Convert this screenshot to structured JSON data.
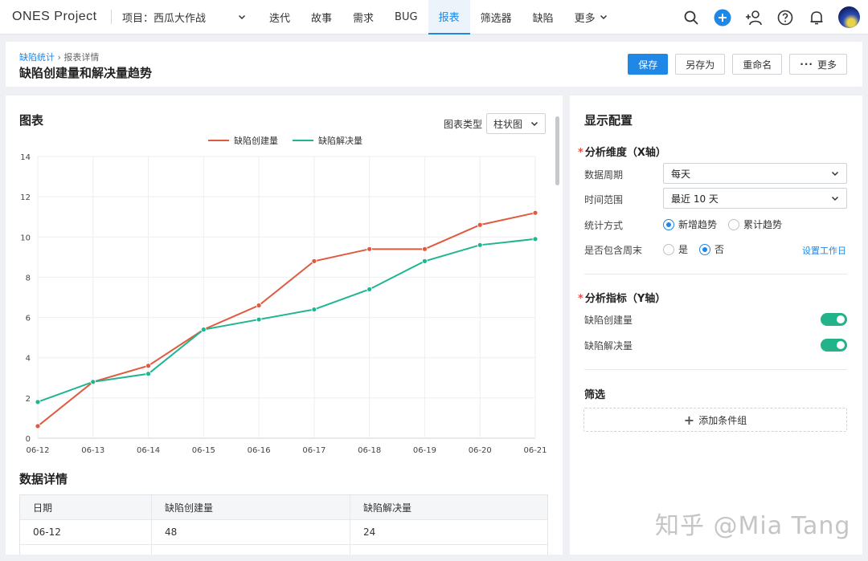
{
  "nav": {
    "brand": "ONES Project",
    "project_label": "项目：",
    "project_name": "西瓜大作战",
    "items": [
      "迭代",
      "故事",
      "需求",
      "BUG",
      "报表",
      "筛选器",
      "缺陷",
      "更多"
    ],
    "active_index": 4
  },
  "header": {
    "breadcrumb_link": "缺陷统计",
    "breadcrumb_sep": "›",
    "breadcrumb_current": "报表详情",
    "title": "缺陷创建量和解决量趋势",
    "save_label": "保存",
    "save_as_label": "另存为",
    "rename_label": "重命名",
    "more_label": "更多"
  },
  "chart_card": {
    "title": "图表",
    "type_label": "图表类型",
    "type_value": "柱状图",
    "details_title": "数据详情"
  },
  "chart_data": {
    "type": "line",
    "categories": [
      "06-12",
      "06-13",
      "06-14",
      "06-15",
      "06-16",
      "06-17",
      "06-18",
      "06-19",
      "06-20",
      "06-21"
    ],
    "series": [
      {
        "name": "缺陷创建量",
        "color": "#e05a3f",
        "values": [
          0.6,
          2.8,
          3.6,
          5.4,
          6.6,
          8.8,
          9.4,
          9.4,
          10.6,
          11.2
        ]
      },
      {
        "name": "缺陷解决量",
        "color": "#1fb591",
        "values": [
          1.8,
          2.8,
          3.2,
          5.4,
          5.9,
          6.4,
          7.4,
          8.8,
          9.6,
          9.9
        ]
      }
    ],
    "ylim": [
      0,
      14
    ],
    "yticks": [
      0,
      2,
      4,
      6,
      8,
      10,
      12,
      14
    ],
    "grid": true,
    "legend": "top-center"
  },
  "table": {
    "headers": [
      "日期",
      "缺陷创建量",
      "缺陷解决量"
    ],
    "rows": [
      [
        "06-12",
        "48",
        "24"
      ],
      [
        "",
        "",
        ""
      ]
    ]
  },
  "config": {
    "title": "显示配置",
    "x_section": "分析维度（X轴）",
    "period_label": "数据周期",
    "period_value": "每天",
    "range_label": "时间范围",
    "range_value": "最近 10 天",
    "method_label": "统计方式",
    "method_new": "新增趋势",
    "method_cum": "累计趋势",
    "weekend_label": "是否包含周末",
    "weekend_yes": "是",
    "weekend_no": "否",
    "workday_link": "设置工作日",
    "y_section": "分析指标（Y轴）",
    "metric_1": "缺陷创建量",
    "metric_2": "缺陷解决量",
    "filter_title": "筛选",
    "add_group": "添加条件组"
  },
  "watermark": "知乎 @Mia Tang"
}
